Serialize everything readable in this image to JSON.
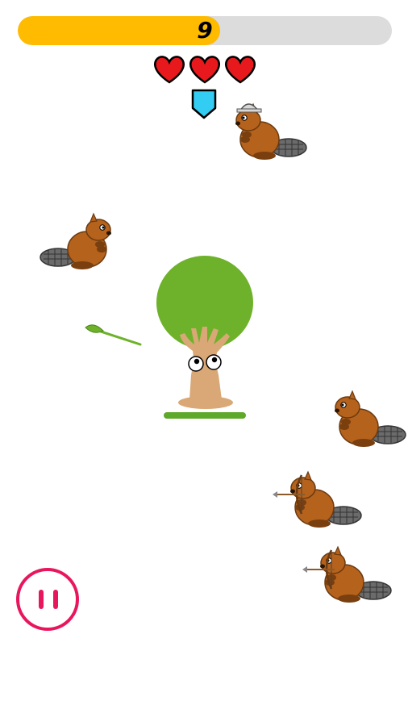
{
  "hud": {
    "score": "9",
    "progress": 0.54,
    "progress_color": "#ffbb00",
    "track_color": "#dcdcdc",
    "lives": 3,
    "heart_icon": "heart-icon",
    "shield_icon": "shield-icon",
    "shield_color": "#33ccf2"
  },
  "player": {
    "name": "tree",
    "canopy_color": "#6db22a",
    "trunk_color": "#d9a876",
    "health_bar_color": "#5ea82a"
  },
  "projectile": {
    "type": "leaf-spear",
    "color": "#6db22a"
  },
  "enemies": [
    {
      "kind": "beaver",
      "variant": "helmet",
      "facing": "left"
    },
    {
      "kind": "beaver",
      "variant": "plain",
      "facing": "right"
    },
    {
      "kind": "beaver",
      "variant": "plain",
      "facing": "left"
    },
    {
      "kind": "beaver",
      "variant": "archer",
      "facing": "left"
    },
    {
      "kind": "beaver",
      "variant": "archer",
      "facing": "left"
    }
  ],
  "controls": {
    "pause_icon": "pause-icon",
    "pause_color": "#e8175d"
  }
}
